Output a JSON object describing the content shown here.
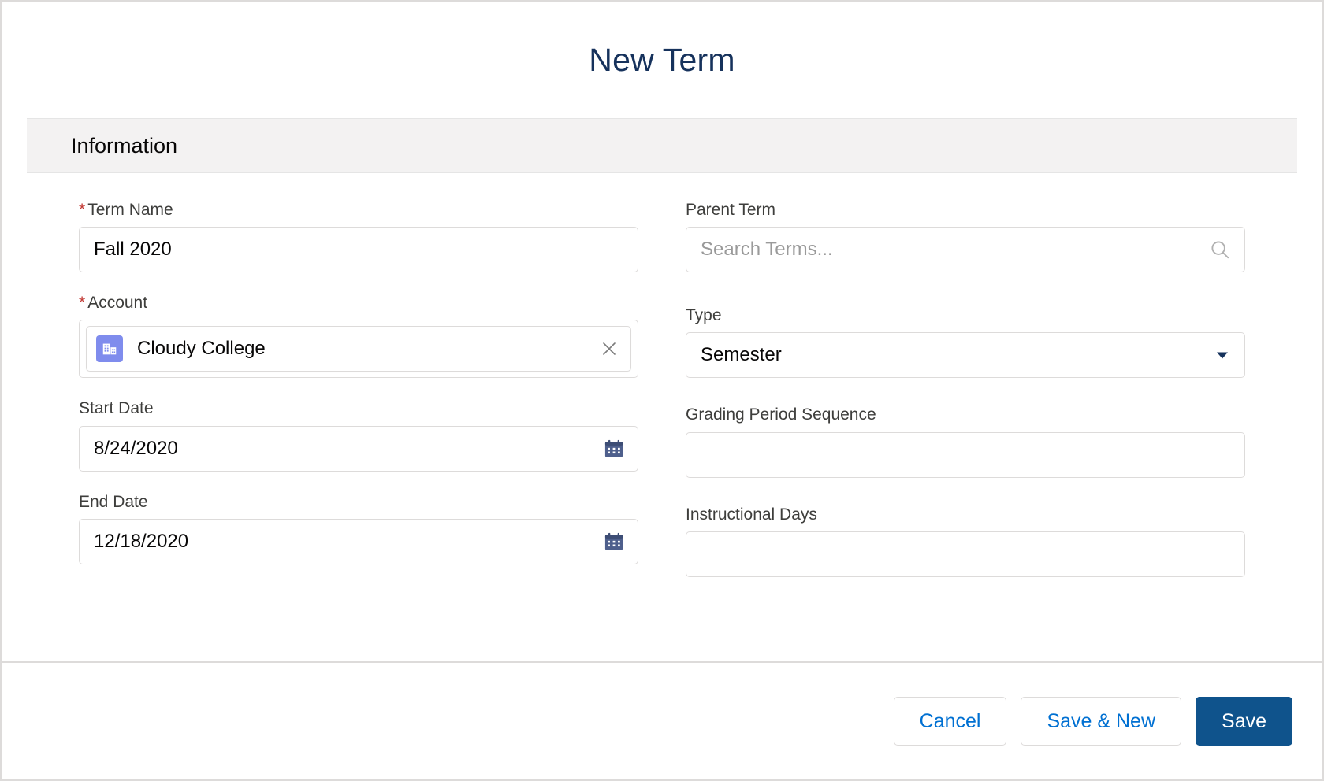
{
  "modal": {
    "title": "New Term",
    "section_title": "Information"
  },
  "form": {
    "left": [
      {
        "label": "Term Name",
        "required": true,
        "required_mark": "*",
        "value": "Fall 2020",
        "type": "text",
        "icon": ""
      },
      {
        "label": "Account",
        "required": true,
        "required_mark": "*",
        "value": "Cloudy College",
        "type": "lookup-pill",
        "icon": "account-building-icon",
        "remove_icon": "close-icon"
      },
      {
        "label": "Start Date",
        "required": false,
        "required_mark": "",
        "value": "8/24/2020",
        "type": "date",
        "icon": "calendar-icon"
      },
      {
        "label": "End Date",
        "required": false,
        "required_mark": "",
        "value": "12/18/2020",
        "type": "date",
        "icon": "calendar-icon"
      }
    ],
    "right": [
      {
        "label": "Parent Term",
        "required": false,
        "required_mark": "",
        "value": "",
        "placeholder": "Search Terms...",
        "type": "search",
        "icon": "search-icon"
      },
      {
        "label": "Type",
        "required": false,
        "required_mark": "",
        "value": "Semester",
        "type": "select",
        "icon": "chevron-down-icon",
        "options": [
          "Semester"
        ]
      },
      {
        "label": "Grading Period Sequence",
        "required": false,
        "required_mark": "",
        "value": "",
        "type": "text",
        "icon": ""
      },
      {
        "label": "Instructional Days",
        "required": false,
        "required_mark": "",
        "value": "",
        "type": "text",
        "icon": ""
      }
    ]
  },
  "footer": {
    "cancel_label": "Cancel",
    "save_new_label": "Save & New",
    "save_label": "Save"
  },
  "colors": {
    "brand_blue": "#0f538c",
    "link_blue": "#0070d2",
    "required_red": "#c23934",
    "account_icon_purple": "#7f8ced",
    "date_icon_blue": "#4e5f8c",
    "section_band": "#f3f2f2",
    "border": "#dddbda"
  }
}
